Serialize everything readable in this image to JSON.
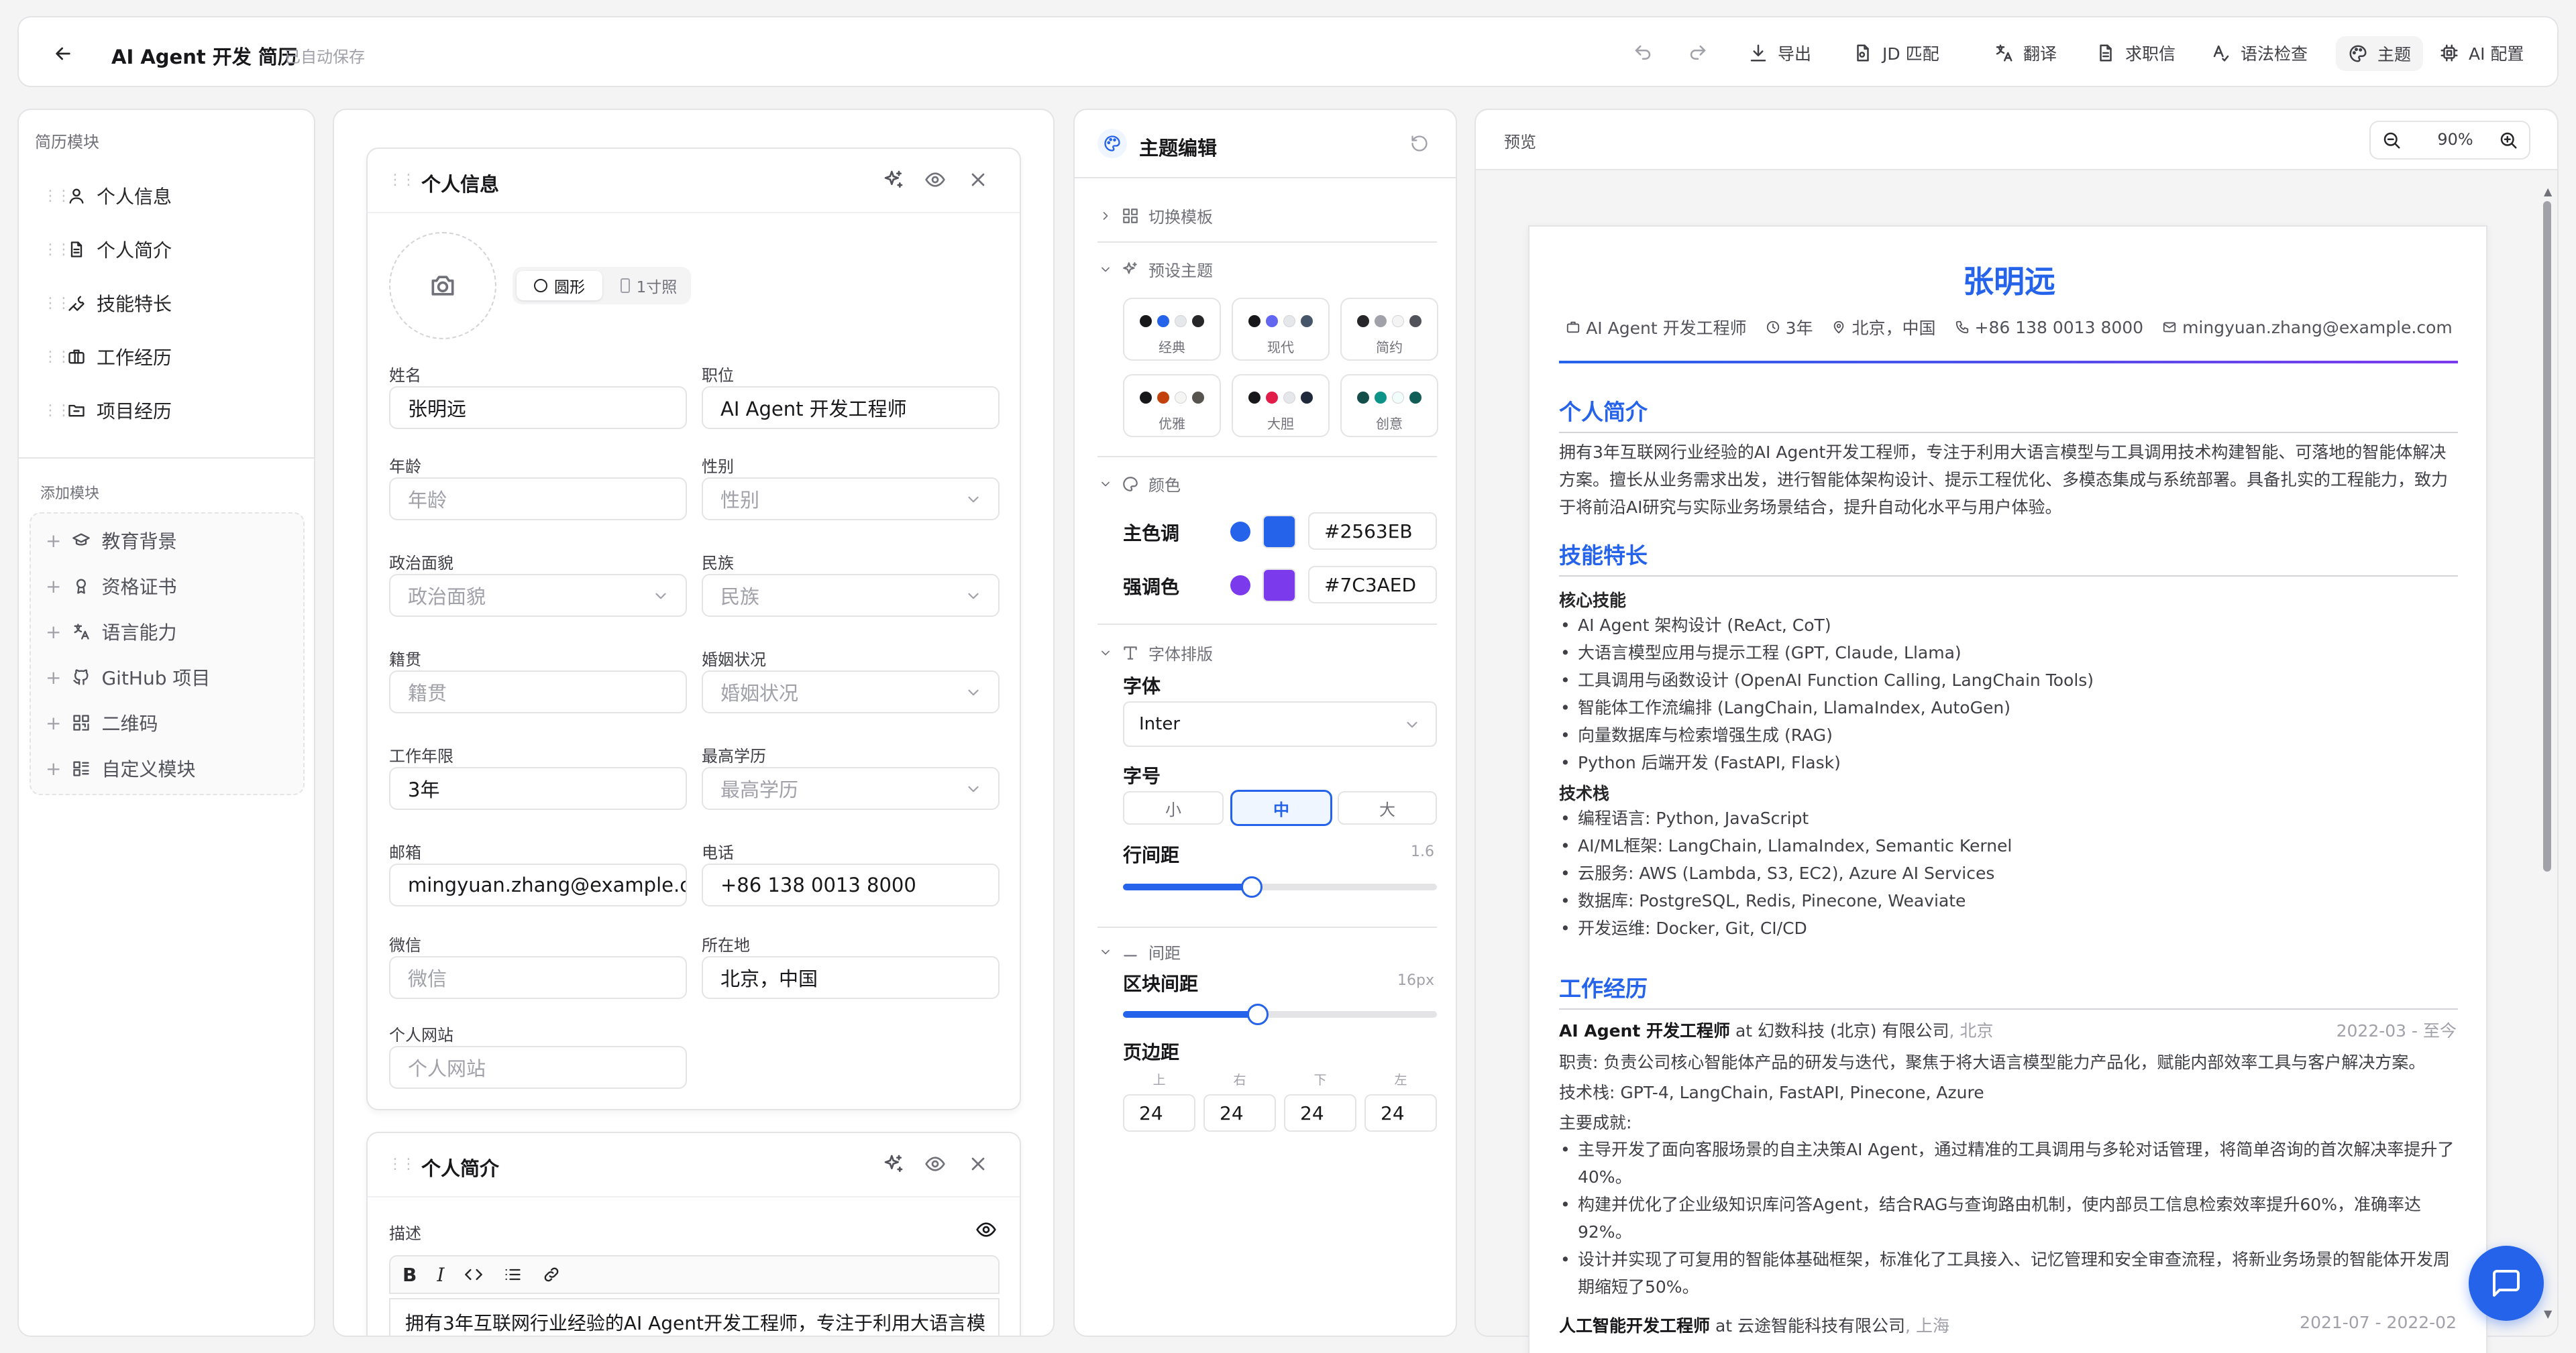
{
  "topbar": {
    "title": "AI Agent 开发 简历",
    "autosave": "已自动保存",
    "buttons": [
      "导出",
      "JD 匹配",
      "翻译",
      "求职信",
      "语法检查",
      "主题",
      "AI 配置"
    ]
  },
  "sidebar": {
    "modules_title": "简历模块",
    "modules": [
      "个人信息",
      "个人简介",
      "技能特长",
      "工作经历",
      "项目经历"
    ],
    "add_title": "添加模块",
    "add_items": [
      "教育背景",
      "资格证书",
      "语言能力",
      "GitHub 项目",
      "二维码",
      "自定义模块"
    ]
  },
  "personal": {
    "section_title": "个人信息",
    "photo_shape_round": "圆形",
    "photo_shape_id": "1寸照",
    "fields": {
      "name": {
        "label": "姓名",
        "value": "张明远"
      },
      "title": {
        "label": "职位",
        "value": "AI Agent 开发工程师"
      },
      "age": {
        "label": "年龄",
        "placeholder": "年龄"
      },
      "gender": {
        "label": "性别",
        "placeholder": "性别"
      },
      "politics": {
        "label": "政治面貌",
        "placeholder": "政治面貌"
      },
      "ethnicity": {
        "label": "民族",
        "placeholder": "民族"
      },
      "hometown": {
        "label": "籍贯",
        "placeholder": "籍贯"
      },
      "marital": {
        "label": "婚姻状况",
        "placeholder": "婚姻状况"
      },
      "years": {
        "label": "工作年限",
        "value": "3年"
      },
      "education": {
        "label": "最高学历",
        "placeholder": "最高学历"
      },
      "email": {
        "label": "邮箱",
        "value": "mingyuan.zhang@example.cc"
      },
      "phone": {
        "label": "电话",
        "value": "+86 138 0013 8000"
      },
      "wechat": {
        "label": "微信",
        "placeholder": "微信"
      },
      "location": {
        "label": "所在地",
        "value": "北京，中国"
      },
      "website": {
        "label": "个人网站",
        "placeholder": "个人网站"
      }
    }
  },
  "summary": {
    "section_title": "个人简介",
    "desc_label": "描述",
    "toolbar": [
      "B",
      "I",
      "<>",
      "list",
      "link"
    ],
    "text": "拥有3年互联网行业经验的AI Agent开发工程师，专注于利用大语言模"
  },
  "theme": {
    "title": "主题编辑",
    "switch_template": "切换模板",
    "presets_title": "预设主题",
    "presets": [
      {
        "name": "经典",
        "colors": [
          "#18181b",
          "#2563eb",
          "#e5e7eb",
          "#27272a"
        ]
      },
      {
        "name": "现代",
        "colors": [
          "#18181b",
          "#6366f1",
          "#e5e7eb",
          "#475569"
        ]
      },
      {
        "name": "简约",
        "colors": [
          "#27272a",
          "#a1a1aa",
          "#f4f4f5",
          "#52525b"
        ]
      },
      {
        "name": "优雅",
        "colors": [
          "#18181b",
          "#c2410c",
          "#f5f5f4",
          "#57534e"
        ]
      },
      {
        "name": "大胆",
        "colors": [
          "#18181b",
          "#e11d48",
          "#e5e7eb",
          "#1e293b"
        ]
      },
      {
        "name": "创意",
        "colors": [
          "#134e4a",
          "#0d9488",
          "#f0fdfa",
          "#115e59"
        ]
      }
    ],
    "color_title": "颜色",
    "primary_label": "主色调",
    "primary_hex": "#2563EB",
    "accent_label": "强调色",
    "accent_hex": "#7C3AED",
    "typo_title": "字体排版",
    "font_label": "字体",
    "font_value": "Inter",
    "size_label": "字号",
    "sizes": [
      "小",
      "中",
      "大"
    ],
    "line_label": "行间距",
    "line_value": "1.6",
    "line_fraction": 0.41,
    "spacing_title": "间距",
    "block_label": "区块间距",
    "block_value": "16px",
    "block_fraction": 0.43,
    "margin_label": "页边距",
    "margins": [
      {
        "label": "上",
        "value": "24"
      },
      {
        "label": "右",
        "value": "24"
      },
      {
        "label": "下",
        "value": "24"
      },
      {
        "label": "左",
        "value": "24"
      }
    ]
  },
  "preview": {
    "title": "预览",
    "zoom": "90%",
    "resume": {
      "name": "张明远",
      "meta": [
        "AI Agent 开发工程师",
        "3年",
        "北京，中国",
        "+86 138 0013 8000",
        "mingyuan.zhang@example.com"
      ],
      "sec_summary": "个人简介",
      "summary_lines": [
        "拥有3年互联网行业经验的AI Agent开发工程师，专注于利用大语言模型与工具调用技术构建智能、可落地的智能体解决",
        "方案。擅长从业务需求出发，进行智能体架构设计、提示工程优化、多模态集成与系统部署。具备扎实的工程能力，致力",
        "于将前沿AI研究与实际业务场景结合，提升自动化水平与用户体验。"
      ],
      "sec_skills": "技能特长",
      "core_title": "核心技能",
      "core": [
        "AI Agent 架构设计 (ReAct, CoT)",
        "大语言模型应用与提示工程 (GPT, Claude, Llama)",
        "工具调用与函数设计 (OpenAI Function Calling, LangChain Tools)",
        "智能体工作流编排 (LangChain, LlamaIndex, AutoGen)",
        "向量数据库与检索增强生成 (RAG)",
        "Python 后端开发 (FastAPI, Flask)"
      ],
      "stack_title": "技术栈",
      "stack": [
        "编程语言: Python, JavaScript",
        "AI/ML框架: LangChain, LlamaIndex, Semantic Kernel",
        "云服务: AWS (Lambda, S3, EC2), Azure AI Services",
        "数据库: PostgreSQL, Redis, Pinecone, Weaviate",
        "开发运维: Docker, Git, CI/CD"
      ],
      "sec_work": "工作经历",
      "job1": {
        "role": "AI Agent 开发工程师",
        "at": "at 幻数科技 (北京) 有限公司",
        "city": ", 北京",
        "date": "2022-03 - 至今",
        "duty": "职责: 负责公司核心智能体产品的研发与迭代，聚焦于将大语言模型能力产品化，赋能内部效率工具与客户解决方案。",
        "tech": "技术栈: GPT-4, LangChain, FastAPI, Pinecone, Azure",
        "ach_title": "主要成就:",
        "ach": [
          "主导开发了面向客服场景的自主决策AI Agent，通过精准的工具调用与多轮对话管理，将简单咨询的首次解决率提升了",
          "40%。",
          "构建并优化了企业级知识库问答Agent，结合RAG与查询路由机制，使内部员工信息检索效率提升60%，准确率达",
          "92%。",
          "设计并实现了可复用的智能体基础框架，标准化了工具接入、记忆管理和安全审查流程，将新业务场景的智能体开发周",
          "期缩短了50%。"
        ]
      },
      "job2": {
        "role": "人工智能开发工程师",
        "at": "at 云途智能科技有限公司",
        "city": ", 上海",
        "date": "2021-07 - 2022-02"
      }
    }
  },
  "colors": {
    "primary": "#2563EB",
    "accent": "#7C3AED",
    "chat_button": "#2563EB"
  }
}
